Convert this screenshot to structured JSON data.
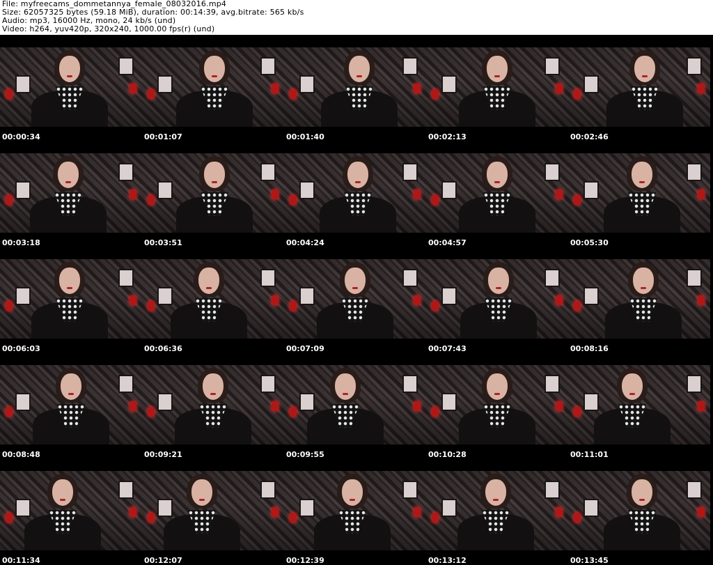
{
  "header": {
    "file": "File: myfreecams_dommetannya_female_08032016.mp4",
    "size": "Size: 62057325 bytes (59.18 MiB), duration: 00:14:39, avg.bitrate: 565 kb/s",
    "audio": "Audio: mp3, 16000 Hz, mono, 24 kb/s (und)",
    "video": "Video: h264, yuv420p, 320x240, 1000.00 fps(r) (und)"
  },
  "thumbnails": [
    {
      "timestamp": "00:00:34"
    },
    {
      "timestamp": "00:01:07"
    },
    {
      "timestamp": "00:01:40"
    },
    {
      "timestamp": "00:02:13"
    },
    {
      "timestamp": "00:02:46"
    },
    {
      "timestamp": "00:03:18"
    },
    {
      "timestamp": "00:03:51"
    },
    {
      "timestamp": "00:04:24"
    },
    {
      "timestamp": "00:04:57"
    },
    {
      "timestamp": "00:05:30"
    },
    {
      "timestamp": "00:06:03"
    },
    {
      "timestamp": "00:06:36"
    },
    {
      "timestamp": "00:07:09"
    },
    {
      "timestamp": "00:07:43"
    },
    {
      "timestamp": "00:08:16"
    },
    {
      "timestamp": "00:08:48"
    },
    {
      "timestamp": "00:09:21"
    },
    {
      "timestamp": "00:09:55"
    },
    {
      "timestamp": "00:10:28"
    },
    {
      "timestamp": "00:11:01"
    },
    {
      "timestamp": "00:11:34"
    },
    {
      "timestamp": "00:12:07"
    },
    {
      "timestamp": "00:12:39"
    },
    {
      "timestamp": "00:13:12"
    },
    {
      "timestamp": "00:13:45"
    }
  ]
}
